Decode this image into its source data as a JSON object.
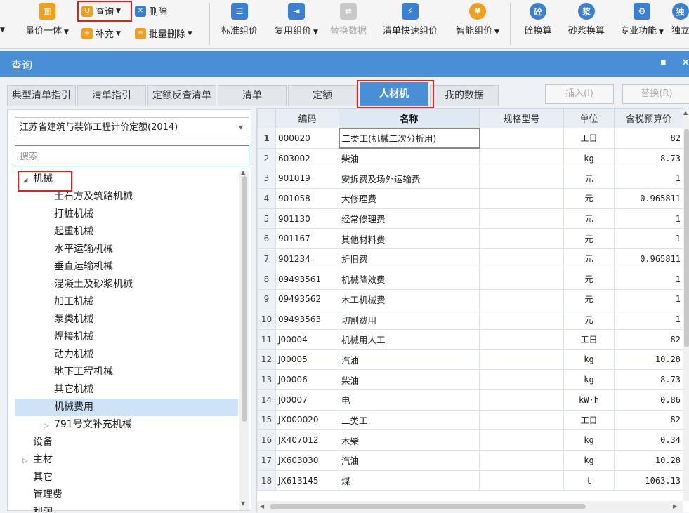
{
  "toolbar": {
    "query": "查询",
    "delete": "删除",
    "quantity_price": "量价一体",
    "supplement": "补充",
    "batch_delete": "批量删除",
    "standard_group": "标准组价",
    "reuse_group": "复用组价",
    "replace_data": "替换数据",
    "quick_group": "清单快速组价",
    "smart_group": "智能组价",
    "concrete_convert": "砼换算",
    "mortar_convert": "砂浆换算",
    "pro_function": "专业功能",
    "independent": "独立"
  },
  "dialog": {
    "title": "查询",
    "tabs": [
      "典型清单指引",
      "清单指引",
      "定额反查清单",
      "清单",
      "定额",
      "人材机",
      "我的数据"
    ],
    "active_tab": "人材机",
    "insert_button": "插入(I)",
    "replace_button": "替换(R)"
  },
  "left": {
    "dropdown_value": "江苏省建筑与装饰工程计价定额(2014)",
    "search_placeholder": "搜索",
    "tree": [
      {
        "label": "机械",
        "level": 0,
        "arrow": "expanded"
      },
      {
        "label": "土石方及筑路机械",
        "level": 1,
        "arrow": ""
      },
      {
        "label": "打桩机械",
        "level": 1,
        "arrow": ""
      },
      {
        "label": "起重机械",
        "level": 1,
        "arrow": ""
      },
      {
        "label": "水平运输机械",
        "level": 1,
        "arrow": ""
      },
      {
        "label": "垂直运输机械",
        "level": 1,
        "arrow": ""
      },
      {
        "label": "混凝土及砂浆机械",
        "level": 1,
        "arrow": ""
      },
      {
        "label": "加工机械",
        "level": 1,
        "arrow": ""
      },
      {
        "label": "泵类机械",
        "level": 1,
        "arrow": ""
      },
      {
        "label": "焊接机械",
        "level": 1,
        "arrow": ""
      },
      {
        "label": "动力机械",
        "level": 1,
        "arrow": ""
      },
      {
        "label": "地下工程机械",
        "level": 1,
        "arrow": ""
      },
      {
        "label": "其它机械",
        "level": 1,
        "arrow": ""
      },
      {
        "label": "机械费用",
        "level": 1,
        "arrow": "",
        "selected": true
      },
      {
        "label": "791号文补充机械",
        "level": 1,
        "arrow": "collapsed"
      },
      {
        "label": "设备",
        "level": 0,
        "arrow": ""
      },
      {
        "label": "主材",
        "level": 0,
        "arrow": "collapsed"
      },
      {
        "label": "其它",
        "level": 0,
        "arrow": ""
      },
      {
        "label": "管理费",
        "level": 0,
        "arrow": ""
      },
      {
        "label": "利润",
        "level": 0,
        "arrow": ""
      }
    ]
  },
  "table": {
    "headers": [
      "编码",
      "名称",
      "规格型号",
      "单位",
      "含税预算价"
    ],
    "rows": [
      {
        "idx": "1",
        "code": "000020",
        "name": "二类工(机械二次分析用)",
        "spec": "",
        "unit": "工日",
        "price": "82"
      },
      {
        "idx": "2",
        "code": "603002",
        "name": "柴油",
        "spec": "",
        "unit": "kg",
        "price": "8.73"
      },
      {
        "idx": "3",
        "code": "901019",
        "name": "安拆费及场外运输费",
        "spec": "",
        "unit": "元",
        "price": "1"
      },
      {
        "idx": "4",
        "code": "901058",
        "name": "大修理费",
        "spec": "",
        "unit": "元",
        "price": "0.965811"
      },
      {
        "idx": "5",
        "code": "901130",
        "name": "经常修理费",
        "spec": "",
        "unit": "元",
        "price": "1"
      },
      {
        "idx": "6",
        "code": "901167",
        "name": "其他材料费",
        "spec": "",
        "unit": "元",
        "price": "1"
      },
      {
        "idx": "7",
        "code": "901234",
        "name": "折旧费",
        "spec": "",
        "unit": "元",
        "price": "0.965811"
      },
      {
        "idx": "8",
        "code": "09493561",
        "name": "机械降效费",
        "spec": "",
        "unit": "元",
        "price": "1"
      },
      {
        "idx": "9",
        "code": "09493562",
        "name": "木工机械费",
        "spec": "",
        "unit": "元",
        "price": "1"
      },
      {
        "idx": "10",
        "code": "09493563",
        "name": "切割费用",
        "spec": "",
        "unit": "元",
        "price": "1"
      },
      {
        "idx": "11",
        "code": "J00004",
        "name": "机械用人工",
        "spec": "",
        "unit": "工日",
        "price": "82"
      },
      {
        "idx": "12",
        "code": "J00005",
        "name": "汽油",
        "spec": "",
        "unit": "kg",
        "price": "10.28"
      },
      {
        "idx": "13",
        "code": "J00006",
        "name": "柴油",
        "spec": "",
        "unit": "kg",
        "price": "8.73"
      },
      {
        "idx": "14",
        "code": "J00007",
        "name": "电",
        "spec": "",
        "unit": "kW·h",
        "price": "0.86"
      },
      {
        "idx": "15",
        "code": "JX000020",
        "name": "二类工",
        "spec": "",
        "unit": "工日",
        "price": "82"
      },
      {
        "idx": "16",
        "code": "JX407012",
        "name": "木柴",
        "spec": "",
        "unit": "kg",
        "price": "0.34"
      },
      {
        "idx": "17",
        "code": "JX603030",
        "name": "汽油",
        "spec": "",
        "unit": "kg",
        "price": "10.28"
      },
      {
        "idx": "18",
        "code": "JX613145",
        "name": "煤",
        "spec": "",
        "unit": "t",
        "price": "1063.13"
      }
    ]
  }
}
